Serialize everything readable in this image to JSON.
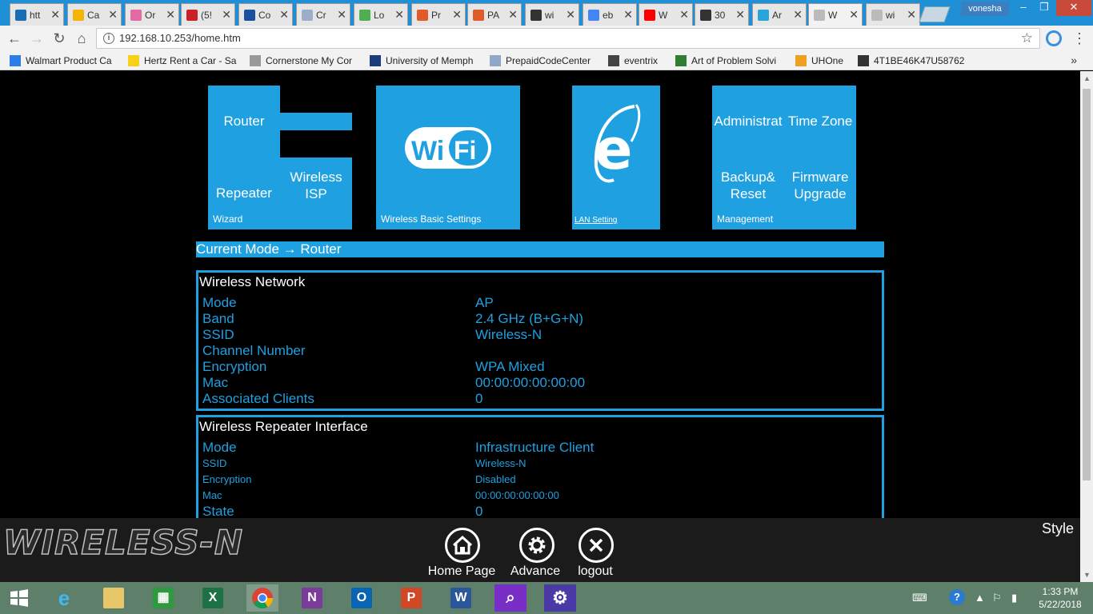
{
  "browser": {
    "tabs": [
      {
        "title": "htt",
        "color": "#1a6db5"
      },
      {
        "title": "Ca",
        "color": "#f4b400"
      },
      {
        "title": "Or",
        "color": "#e26aa6"
      },
      {
        "title": "(5!",
        "color": "#cb2027"
      },
      {
        "title": "Co",
        "color": "#1d4fa0"
      },
      {
        "title": "Cr",
        "color": "#9bb0c8"
      },
      {
        "title": "Lo",
        "color": "#4caf50"
      },
      {
        "title": "Pr",
        "color": "#e05a2a"
      },
      {
        "title": "PA",
        "color": "#e05a2a"
      },
      {
        "title": "wi",
        "color": "#333333"
      },
      {
        "title": "eb",
        "color": "#4285f4"
      },
      {
        "title": "W",
        "color": "#ff0000"
      },
      {
        "title": "30",
        "color": "#333333"
      },
      {
        "title": "Ar",
        "color": "#26a5d8"
      },
      {
        "title": "W",
        "color": "#bbbbbb"
      },
      {
        "title": "wi",
        "color": "#bbbbbb"
      }
    ],
    "user": "vonesha",
    "url": "192.168.10.253/home.htm",
    "bookmarks": [
      {
        "label": "Walmart Product Ca",
        "color": "#2b7de9"
      },
      {
        "label": "Hertz Rent a Car - Sa",
        "color": "#f7d117"
      },
      {
        "label": "Cornerstone My Cor",
        "color": "#999999"
      },
      {
        "label": "University of Memph",
        "color": "#1b3b7a"
      },
      {
        "label": "PrepaidCodeCenter",
        "color": "#8fa8c8"
      },
      {
        "label": "eventrix",
        "color": "#444444"
      },
      {
        "label": "Art of Problem Solvi",
        "color": "#2e7d32"
      },
      {
        "label": "UHOne",
        "color": "#f0a020"
      },
      {
        "label": "4T1BE46K47U58762",
        "color": "#333333"
      }
    ]
  },
  "tiles": {
    "wizard": {
      "router": "Router",
      "repeater": "Repeater",
      "wisp": "Wireless ISP",
      "footer": "Wizard"
    },
    "wifi": {
      "footer": "Wireless Basic Settings",
      "logo_left": "Wi",
      "logo_right": "Fi"
    },
    "lan": {
      "footer": "LAN Setting",
      "logo": "e"
    },
    "management": {
      "admin": "Administrat",
      "timezone": "Time Zone",
      "backup": "Backup& Reset",
      "firmware": "Firmware Upgrade",
      "footer": "Management"
    }
  },
  "current_mode": "Current Mode → Router",
  "wireless_network": {
    "title": "Wireless Network",
    "rows": [
      {
        "key": "Mode",
        "value": "AP"
      },
      {
        "key": "Band",
        "value": "2.4 GHz (B+G+N)"
      },
      {
        "key": "SSID",
        "value": "Wireless-N"
      },
      {
        "key": "Channel Number",
        "value": ""
      },
      {
        "key": "Encryption",
        "value": "WPA Mixed"
      },
      {
        "key": "Mac",
        "value": "00:00:00:00:00:00"
      },
      {
        "key": "Associated Clients",
        "value": "0"
      }
    ]
  },
  "repeater_interface": {
    "title": "Wireless Repeater Interface",
    "rows": [
      {
        "key": "Mode",
        "value": "Infrastructure Client"
      },
      {
        "key": "SSID",
        "value": "Wireless-N"
      },
      {
        "key": "Encryption",
        "value": "Disabled"
      },
      {
        "key": "Mac",
        "value": "00:00:00:00:00:00"
      },
      {
        "key": "State",
        "value": "0"
      }
    ]
  },
  "footer": {
    "brand": "WIRELESS-N",
    "home": "Home Page",
    "advance": "Advance",
    "logout": "logout",
    "style": "Style"
  },
  "taskbar": {
    "time": "1:33 PM",
    "date": "5/22/2018",
    "apps": [
      "start",
      "internet-explorer",
      "file-explorer",
      "store",
      "excel",
      "chrome",
      "onenote",
      "outlook",
      "powerpoint",
      "word",
      "search",
      "settings"
    ]
  },
  "colors": {
    "accent": "#1fa0e0",
    "page_bg": "#000000",
    "bar_bg": "#1b1b1b"
  }
}
